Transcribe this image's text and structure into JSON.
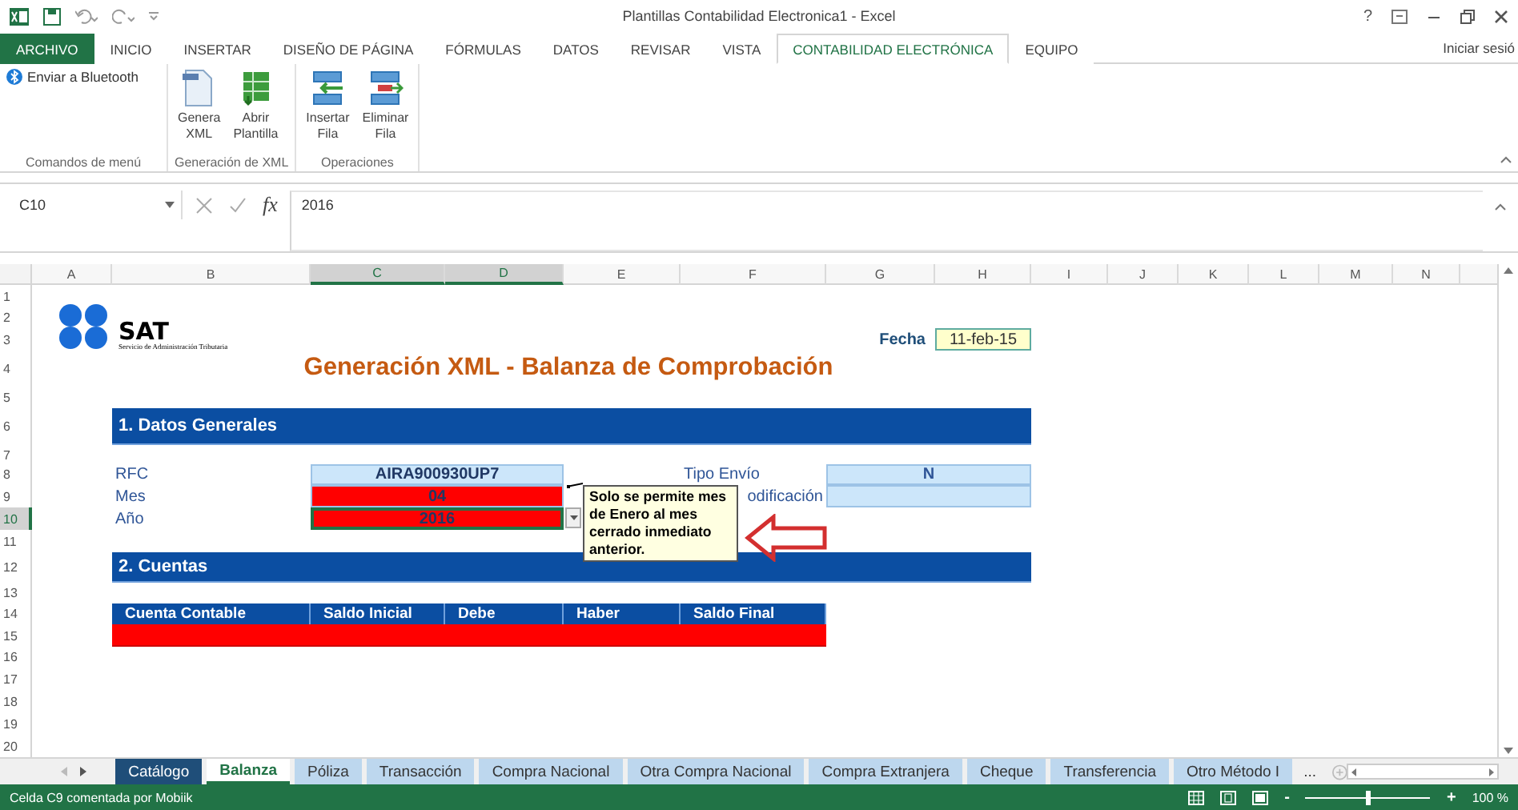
{
  "title_bar": {
    "title": "Plantillas Contabilidad Electronica1 - Excel",
    "help": "?"
  },
  "ribbon_tabs": [
    {
      "label": "ARCHIVO",
      "kind": "file",
      "selected": false
    },
    {
      "label": "INICIO",
      "kind": "tab",
      "selected": false
    },
    {
      "label": "INSERTAR",
      "kind": "tab",
      "selected": false
    },
    {
      "label": "DISEÑO DE PÁGINA",
      "kind": "tab",
      "selected": false
    },
    {
      "label": "FÓRMULAS",
      "kind": "tab",
      "selected": false
    },
    {
      "label": "DATOS",
      "kind": "tab",
      "selected": false
    },
    {
      "label": "REVISAR",
      "kind": "tab",
      "selected": false
    },
    {
      "label": "VISTA",
      "kind": "tab",
      "selected": false
    },
    {
      "label": "CONTABILIDAD ELECTRÓNICA",
      "kind": "tab",
      "selected": true
    },
    {
      "label": "EQUIPO",
      "kind": "tab",
      "selected": false
    }
  ],
  "account": "Iniciar sesió",
  "ribbon_groups": [
    {
      "label": "Comandos de menú",
      "buttons": [
        {
          "label": "Enviar a Bluetooth",
          "kind": "small"
        }
      ]
    },
    {
      "label": "Generación de XML",
      "buttons": [
        {
          "label": "Genera XML",
          "kind": "large"
        },
        {
          "label": "Abrir Plantilla",
          "kind": "large"
        }
      ]
    },
    {
      "label": "Operaciones",
      "buttons": [
        {
          "label": "Insertar Fila",
          "kind": "large"
        },
        {
          "label": "Eliminar Fila",
          "kind": "large"
        }
      ]
    }
  ],
  "formula_bar": {
    "name_box": "C10",
    "function_label": "fx",
    "value": "2016"
  },
  "columns": [
    {
      "label": "A",
      "selected": false
    },
    {
      "label": "B",
      "selected": false
    },
    {
      "label": "C",
      "selected": true
    },
    {
      "label": "D",
      "selected": true
    },
    {
      "label": "E",
      "selected": false
    },
    {
      "label": "F",
      "selected": false
    },
    {
      "label": "G",
      "selected": false
    },
    {
      "label": "H",
      "selected": false
    },
    {
      "label": "I",
      "selected": false
    },
    {
      "label": "J",
      "selected": false
    },
    {
      "label": "K",
      "selected": false
    },
    {
      "label": "L",
      "selected": false
    },
    {
      "label": "M",
      "selected": false
    },
    {
      "label": "N",
      "selected": false
    }
  ],
  "rows": [
    {
      "label": "1",
      "selected": false
    },
    {
      "label": "2",
      "selected": false
    },
    {
      "label": "3",
      "selected": false
    },
    {
      "label": "4",
      "selected": false
    },
    {
      "label": "5",
      "selected": false
    },
    {
      "label": "6",
      "selected": false
    },
    {
      "label": "7",
      "selected": false
    },
    {
      "label": "8",
      "selected": false
    },
    {
      "label": "9",
      "selected": false
    },
    {
      "label": "10",
      "selected": true
    },
    {
      "label": "11",
      "selected": false
    },
    {
      "label": "12",
      "selected": false
    },
    {
      "label": "13",
      "selected": false
    },
    {
      "label": "14",
      "selected": false
    },
    {
      "label": "15",
      "selected": false
    },
    {
      "label": "16",
      "selected": false
    },
    {
      "label": "17",
      "selected": false
    },
    {
      "label": "18",
      "selected": false
    },
    {
      "label": "19",
      "selected": false
    },
    {
      "label": "20",
      "selected": false
    }
  ],
  "sheet": {
    "logo": {
      "name": "SAT",
      "subtitle": "Servicio de Administración Tributaria"
    },
    "title": "Generación XML - Balanza de Comprobación",
    "date": {
      "label": "Fecha",
      "value": "11-feb-15"
    },
    "section_1": "1. Datos Generales",
    "general_fields": [
      {
        "label": "RFC",
        "value": "AIRA900930UP7",
        "valid": true,
        "selected": false
      },
      {
        "label": "Mes",
        "value": "04",
        "valid": false,
        "selected": false
      },
      {
        "label": "Año",
        "value": "2016",
        "valid": false,
        "selected": true
      }
    ],
    "side_fields": [
      {
        "label": "Tipo Envío",
        "value": "N"
      },
      {
        "label": "odificación"
      }
    ],
    "comment": "Solo se permite mes de Enero al mes cerrado inmediato anterior.",
    "section_2": "2. Cuentas",
    "accounts_table": {
      "columns": [
        "Cuenta Contable",
        "Saldo Inicial",
        "Debe",
        "Haber",
        "Saldo Final"
      ],
      "rows": [
        {
          "valid": false
        }
      ]
    }
  },
  "sheet_tabs": [
    {
      "label": "Catálogo",
      "selected": false,
      "color": "#1f4e79"
    },
    {
      "label": "Balanza",
      "selected": true
    },
    {
      "label": "Póliza",
      "selected": false,
      "color": "#bdd7ee"
    },
    {
      "label": "Transacción",
      "selected": false,
      "color": "#bdd7ee"
    },
    {
      "label": "Compra Nacional",
      "selected": false,
      "color": "#bdd7ee"
    },
    {
      "label": "Otra Compra Nacional",
      "selected": false,
      "color": "#bdd7ee"
    },
    {
      "label": "Compra Extranjera",
      "selected": false,
      "color": "#bdd7ee"
    },
    {
      "label": "Cheque",
      "selected": false,
      "color": "#bdd7ee"
    },
    {
      "label": "Transferencia",
      "selected": false,
      "color": "#bdd7ee"
    },
    {
      "label": "Otro Método I",
      "selected": false,
      "color": "#bdd7ee"
    }
  ],
  "more_tabs": "...",
  "status_bar": {
    "text": "Celda C9 comentada por Mobiik",
    "zoom_out": "-",
    "zoom_in": "+",
    "zoom_slider": {
      "level": 0.5
    },
    "zoom": "100 %"
  }
}
